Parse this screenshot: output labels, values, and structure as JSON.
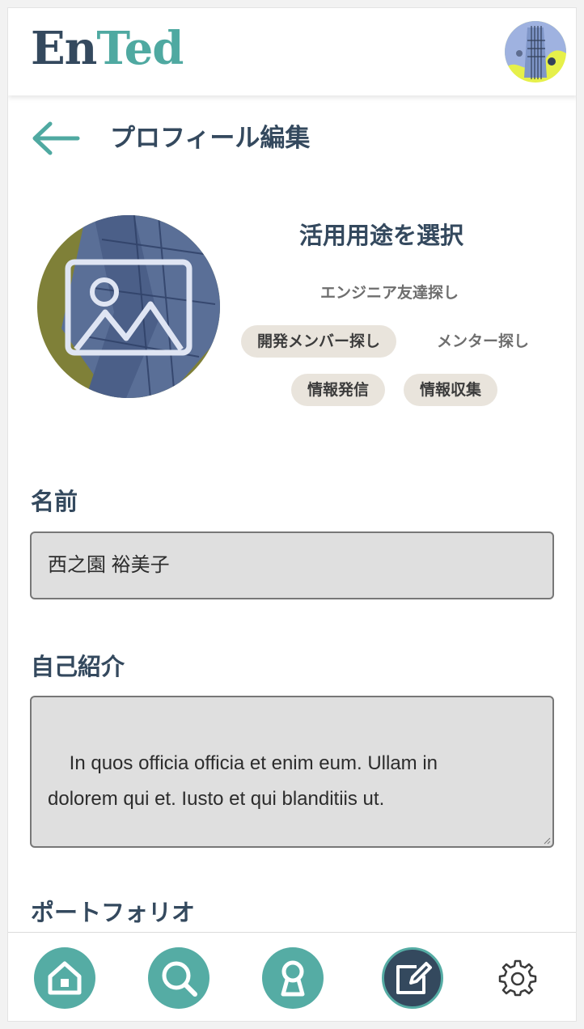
{
  "header": {
    "logo_part1": "En",
    "logo_part2": "Ted",
    "avatar_icon": "guitar-avatar"
  },
  "page": {
    "title": "プロフィール編集",
    "back_icon": "arrow-left-icon"
  },
  "profile_image": {
    "icon": "image-placeholder-icon"
  },
  "purposes": {
    "title": "活用用途を選択",
    "items": [
      {
        "label": "エンジニア友達探し",
        "selected": false
      },
      {
        "label": "開発メンバー探し",
        "selected": true
      },
      {
        "label": "メンター探し",
        "selected": false
      },
      {
        "label": "情報発信",
        "selected": true
      },
      {
        "label": "情報収集",
        "selected": true
      }
    ]
  },
  "form": {
    "name_label": "名前",
    "name_value": "西之園 裕美子",
    "bio_label": "自己紹介",
    "bio_value": "In quos officia officia et enim eum. Ullam in\ndolorem qui et. Iusto et qui blanditiis ut.",
    "portfolio_label": "ポートフォリオ"
  },
  "nav": {
    "items": [
      "home-icon",
      "search-icon",
      "mentor-icon",
      "edit-icon",
      "gear-icon"
    ],
    "active": "edit-icon"
  },
  "colors": {
    "brand_dark": "#34495e",
    "brand_teal": "#4fa9a1",
    "tag_bg": "#e9e4dc",
    "input_bg": "#dfdfdf"
  }
}
